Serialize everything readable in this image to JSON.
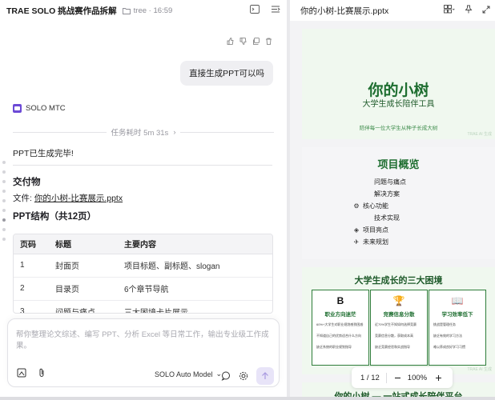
{
  "app": {
    "project_title": "TRAE SOLO 挑战赛作品拆解",
    "folder_name": "tree",
    "folder_time": "16:59"
  },
  "chat": {
    "user_message": "直接生成PPT可以吗",
    "agent_name": "SOLO MTC",
    "elapsed": "任务耗时 5m 31s",
    "done_text": "PPT已生成完毕!",
    "deliver_heading": "交付物",
    "file_label": "文件: ",
    "file_link": "你的小树-比赛展示.pptx",
    "struct_heading": "PPT结构（共12页）",
    "table": {
      "headers": [
        "页码",
        "标题",
        "主要内容"
      ],
      "rows": [
        [
          "1",
          "封面页",
          "项目标题、副标题、slogan"
        ],
        [
          "2",
          "目录页",
          "6个章节导航"
        ],
        [
          "3",
          "问题与痛点",
          "三大困境卡片展示"
        ]
      ]
    }
  },
  "composer": {
    "placeholder": "帮你整理论文综述、编写 PPT、分析 Excel 等日常工作，输出专业级工作成果。",
    "model": "SOLO Auto Model"
  },
  "preview": {
    "file_title": "你的小树-比赛展示.pptx",
    "slide1": {
      "title": "你的小树",
      "subtitle": "大学生成长陪伴工具",
      "slogan": "陪伴每一位大学生从种子长成大树",
      "footer": "TRAE AI 生成"
    },
    "slide2": {
      "title": "项目概览",
      "items": [
        {
          "label": "问题与痛点",
          "icon": ""
        },
        {
          "label": "解决方案",
          "icon": ""
        },
        {
          "label": "核心功能",
          "icon": "gear-icon"
        },
        {
          "label": "技术实现",
          "icon": ""
        },
        {
          "label": "项目亮点",
          "icon": "diamond-icon"
        },
        {
          "label": "未来规划",
          "icon": "sprout-icon"
        }
      ]
    },
    "slide3": {
      "title": "大学生成长的三大困境",
      "footer": "TRAE AI 生成",
      "cards": [
        {
          "icon_text": "B",
          "title": "职业方向迷茫",
          "bullets": [
            "60%+大学生对职业规划感到困惑",
            "不知道自己的优势适合什么方向",
            "缺乏系统的职业规划指导"
          ]
        },
        {
          "icon_text": "🏆",
          "title": "竞赛信息分散",
          "bullets": [
            "近70%学生不知如何选择竞赛",
            "竞赛信息分散，获取成本高",
            "缺乏竞赛经验和实战指导"
          ]
        },
        {
          "icon_text": "📖",
          "title": "学习效率低下",
          "bullets": [
            "挑战是管理任务",
            "缺乏有效的学习方法",
            "难以养成良好学习习惯"
          ]
        }
      ]
    },
    "slide4": {
      "title": "你的小树 — 一站式成长陪伴平台"
    },
    "pager": {
      "page": "1 / 12",
      "zoom": "100%"
    }
  },
  "colors": {
    "accent": "#1e6e30",
    "brand": "#6c4ad6"
  }
}
